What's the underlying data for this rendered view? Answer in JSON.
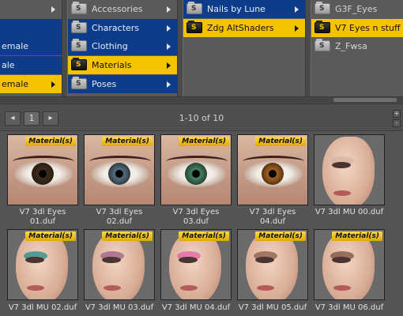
{
  "col1": {
    "items": [
      {
        "label": "",
        "state": "plain"
      },
      {
        "label": "",
        "state": "blue"
      },
      {
        "label": "emale",
        "state": "blue"
      },
      {
        "label": "ale",
        "state": "blue"
      },
      {
        "label": "emale",
        "state": "selected"
      }
    ]
  },
  "col2": {
    "items": [
      {
        "label": "Accessories",
        "state": "plain"
      },
      {
        "label": "Characters",
        "state": "blue"
      },
      {
        "label": "Clothing",
        "state": "blue"
      },
      {
        "label": "Materials",
        "state": "selected"
      },
      {
        "label": "Poses",
        "state": "blue"
      }
    ]
  },
  "col3": {
    "items": [
      {
        "label": "Nails by Lune",
        "state": "blue"
      },
      {
        "label": "Zdg AltShaders",
        "state": "selected"
      }
    ]
  },
  "col4": {
    "items": [
      {
        "label": "G3F_Eyes",
        "state": "plain"
      },
      {
        "label": "V7 Eyes n stuff",
        "state": "selected"
      },
      {
        "label": "Z_Fwsa",
        "state": "plain"
      }
    ]
  },
  "folder_icon_letter": "S",
  "pager": {
    "prev_symbol": "◂",
    "page": "1",
    "next_symbol": "▸",
    "count_text": "1-10 of 10",
    "plus_symbol": "+",
    "minus_symbol": "-"
  },
  "badge_text": "Material(s)",
  "assets": [
    {
      "caption_line1": "V7 3dl Eyes",
      "caption_line2": "01.duf",
      "kind": "eye",
      "iris_color": "#3a2a18"
    },
    {
      "caption_line1": "V7 3dl Eyes",
      "caption_line2": "02.duf",
      "kind": "eye",
      "iris_color": "#4f6878"
    },
    {
      "caption_line1": "V7 3dl Eyes",
      "caption_line2": "03.duf",
      "kind": "eye",
      "iris_color": "#3f7a5e"
    },
    {
      "caption_line1": "V7 3dl Eyes",
      "caption_line2": "04.duf",
      "kind": "eye",
      "iris_color": "#9a5a1c"
    },
    {
      "caption_line1": "V7 3dl MU 00.duf",
      "caption_line2": "",
      "kind": "face",
      "shadow_color": "#d7b3a0"
    },
    {
      "caption_line1": "V7 3dl MU 02.duf",
      "caption_line2": "",
      "kind": "face",
      "shadow_color": "#1f8c8c"
    },
    {
      "caption_line1": "V7 3dl MU 03.duf",
      "caption_line2": "",
      "kind": "face",
      "shadow_color": "#9c5c8c"
    },
    {
      "caption_line1": "V7 3dl MU 04.duf",
      "caption_line2": "",
      "kind": "face",
      "shadow_color": "#e060a8"
    },
    {
      "caption_line1": "V7 3dl MU 05.duf",
      "caption_line2": "",
      "kind": "face",
      "shadow_color": "#8a5a4a"
    },
    {
      "caption_line1": "V7 3dl MU 06.duf",
      "caption_line2": "",
      "kind": "face",
      "shadow_color": "#7a4e3e"
    }
  ],
  "colors": {
    "selected": "#f5c200",
    "blue": "#0d3d8a",
    "panel": "#5a5a5a"
  }
}
